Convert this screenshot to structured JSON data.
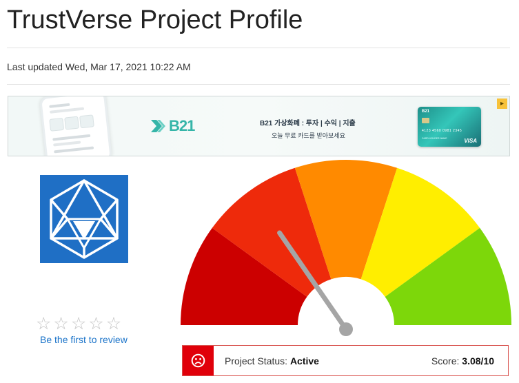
{
  "page": {
    "title": "TrustVerse Project Profile",
    "last_updated": "Last updated Wed, Mar 17, 2021 10:22 AM"
  },
  "ad": {
    "brand": "B21",
    "headline": "B21 가상화폐 : 투자 | 수익 | 지출",
    "subline": "오늘 무료 카드를 받아보세요",
    "card_brand": "B21",
    "card_number": "4123 4560 0981 2345",
    "card_holder": "CARD HOLDER NAME",
    "card_network": "VISA",
    "brand_color": "#35b5a8"
  },
  "project_logo": {
    "icon": "icosahedron-logo-icon",
    "background": "#1f6fc5"
  },
  "rating": {
    "stars_filled": 0,
    "stars_total": 5,
    "review_link": "Be the first to review"
  },
  "gauge": {
    "score": 3.08,
    "max": 10,
    "segment_colors": [
      "#cc0000",
      "#ee2a0b",
      "#ff8a00",
      "#ffee00",
      "#7dd70a"
    ]
  },
  "status": {
    "icon": "sad-face-icon",
    "label": "Project Status:",
    "value": "Active",
    "score_label": "Score:",
    "score_value": "3.08/10",
    "accent": "#e0000a"
  }
}
